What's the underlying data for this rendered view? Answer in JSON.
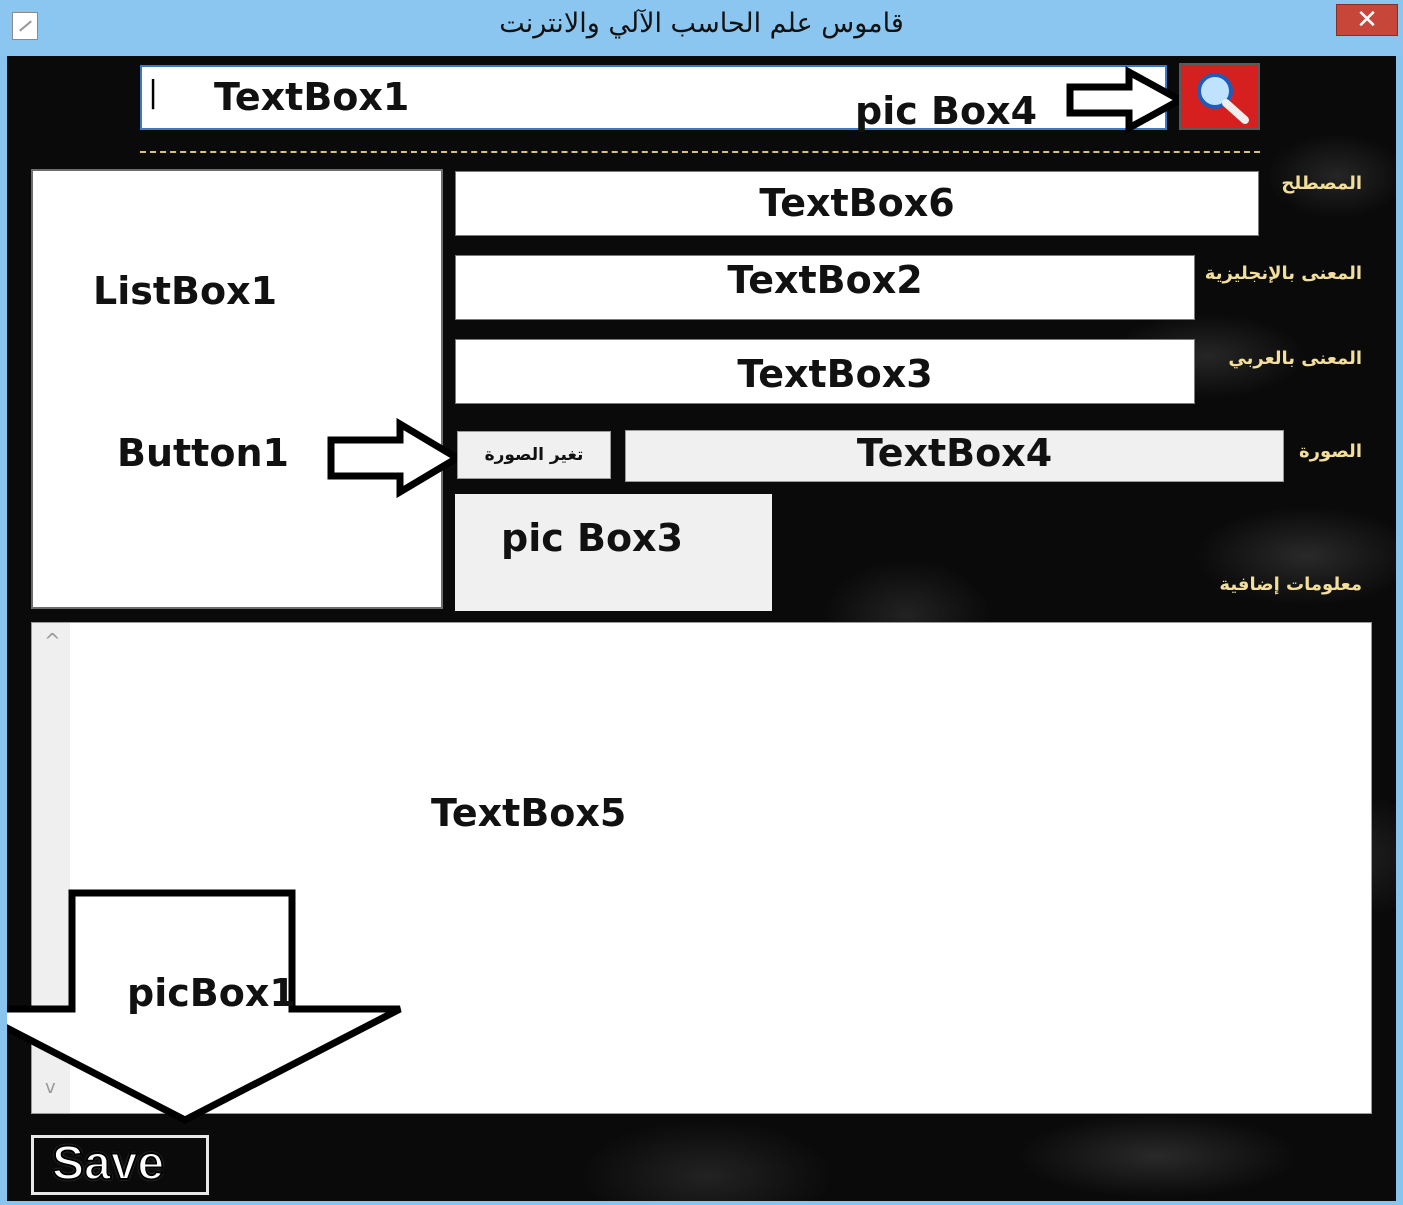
{
  "window": {
    "title": "قاموس علم الحاسب الآلي والانترنت",
    "close_glyph": "✕"
  },
  "search": {
    "textbox_label": "TextBox1",
    "caret": "|",
    "picbox_label": "pic Box4",
    "icon": "magnifier-icon",
    "button_color": "#d62020"
  },
  "fields": {
    "term_label": "المصطلح",
    "term_box": "TextBox6",
    "english_label": "المعنى بالإنجليزية",
    "english_box": "TextBox2",
    "arabic_label": "المعنى بالعربي",
    "arabic_box": "TextBox3",
    "image_label": "الصورة",
    "image_box": "TextBox4",
    "change_image_button": "تغير الصورة",
    "picbox3_label": "pic Box3",
    "extra_info_label": "معلومات إضافية"
  },
  "left_panel": {
    "listbox_label": "ListBox1",
    "button_label": "Button1"
  },
  "notes": {
    "textbox_label": "TextBox5",
    "scroll_up": "^",
    "scroll_down": "v"
  },
  "footer": {
    "picbox1_label": "picBox1",
    "save_label": "Save"
  },
  "colors": {
    "titlebar": "#8ac6ef",
    "label_gold": "#f3df9b",
    "close_red": "#c7463a"
  }
}
